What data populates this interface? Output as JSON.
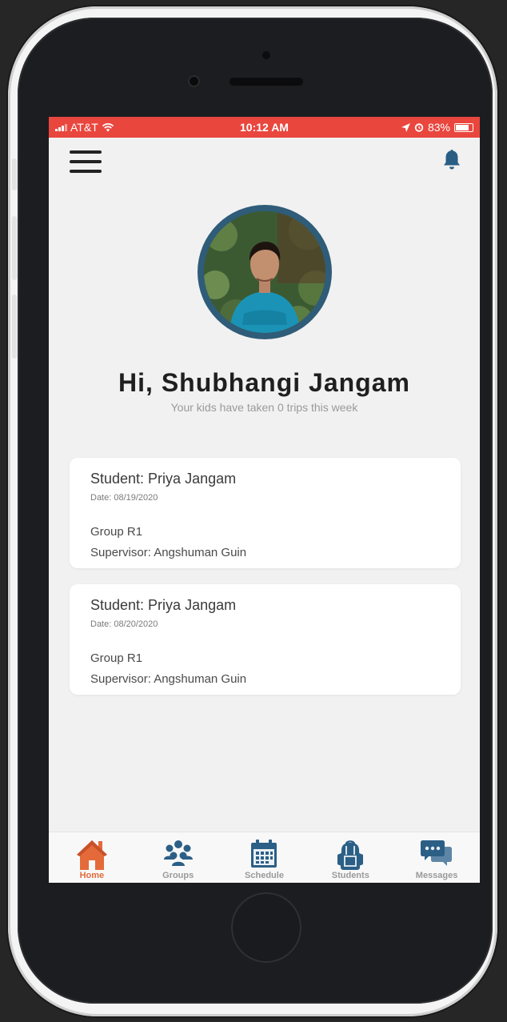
{
  "status_bar": {
    "carrier": "AT&T",
    "time": "10:12 AM",
    "battery": "83%"
  },
  "header": {
    "menu_icon": "hamburger-menu-icon",
    "notification_icon": "bell-icon"
  },
  "profile": {
    "greeting": "Hi, Shubhangi Jangam",
    "subtitle": "Your kids have taken 0 trips this week"
  },
  "trips": [
    {
      "student": "Student: Priya Jangam",
      "date": "Date: 08/19/2020",
      "group": "Group R1",
      "supervisor": "Supervisor: Angshuman Guin"
    },
    {
      "student": "Student: Priya Jangam",
      "date": "Date: 08/20/2020",
      "group": "Group R1",
      "supervisor": "Supervisor: Angshuman Guin"
    }
  ],
  "tabs": [
    {
      "label": "Home",
      "icon": "home-icon",
      "active": true
    },
    {
      "label": "Groups",
      "icon": "groups-icon",
      "active": false
    },
    {
      "label": "Schedule",
      "icon": "calendar-icon",
      "active": false
    },
    {
      "label": "Students",
      "icon": "backpack-icon",
      "active": false
    },
    {
      "label": "Messages",
      "icon": "chat-icon",
      "active": false
    }
  ],
  "colors": {
    "status_bar": "#e9463e",
    "accent": "#e46a3a",
    "inactive_icon": "#2b5f86",
    "avatar_ring": "#2f5c78"
  }
}
